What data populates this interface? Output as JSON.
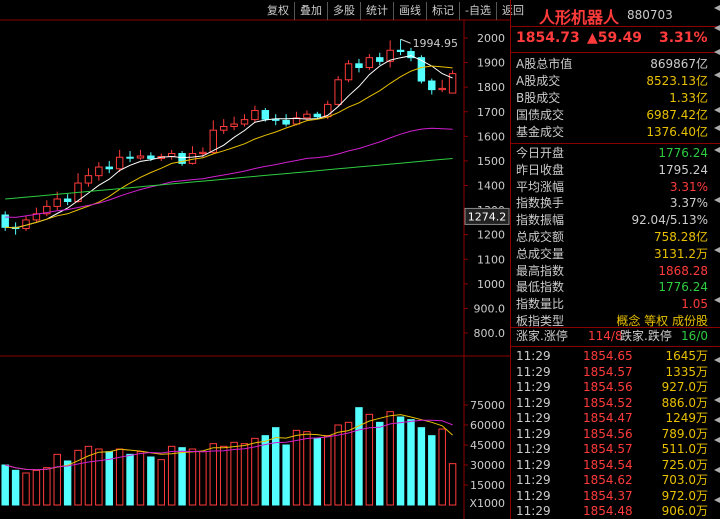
{
  "toolbar": [
    "复权",
    "叠加",
    "多股",
    "统计",
    "画线",
    "标记",
    "-自选",
    "返回"
  ],
  "stock": {
    "name": "人形机器人",
    "code": "880703",
    "price": "1854.73",
    "change": "▲59.49",
    "change_pct": "3.31%"
  },
  "summary": [
    {
      "label": "A股总市值",
      "value": "869867亿",
      "color": "#cccccc"
    },
    {
      "label": "A股成交",
      "value": "8523.13亿",
      "color": "#e8c000"
    },
    {
      "label": "B股成交",
      "value": "1.33亿",
      "color": "#e8c000"
    },
    {
      "label": "国债成交",
      "value": "6987.42亿",
      "color": "#e8c000"
    },
    {
      "label": "基金成交",
      "value": "1376.40亿",
      "color": "#e8c000"
    }
  ],
  "stats": [
    {
      "label": "今日开盘",
      "value": "1776.24",
      "color": "#2ecc40"
    },
    {
      "label": "昨日收盘",
      "value": "1795.24",
      "color": "#cccccc"
    },
    {
      "label": "平均涨幅",
      "value": "3.31%",
      "color": "#ff3b3b"
    },
    {
      "label": "指数换手",
      "value": "3.37%",
      "color": "#cccccc"
    },
    {
      "label": "指数振幅",
      "value": "92.04/5.13%",
      "color": "#cccccc"
    },
    {
      "label": "总成交额",
      "value": "758.28亿",
      "color": "#e8c000"
    },
    {
      "label": "总成交量",
      "value": "3131.2万",
      "color": "#e8c000"
    },
    {
      "label": "最高指数",
      "value": "1868.28",
      "color": "#ff3b3b"
    },
    {
      "label": "最低指数",
      "value": "1776.24",
      "color": "#2ecc40"
    },
    {
      "label": "指数量比",
      "value": "1.05",
      "color": "#ff3b3b"
    },
    {
      "label": "板指类型",
      "value": "概念 等权 成份股",
      "color": "#e8c000"
    }
  ],
  "breadth": {
    "up_label": "涨家.涨停",
    "up_value": "114/8",
    "down_label": "跌家.跌停",
    "down_value": "16/0"
  },
  "ticks": [
    {
      "time": "11:29",
      "price": "1854.65",
      "vol": "1645万"
    },
    {
      "time": "11:29",
      "price": "1854.57",
      "vol": "1335万"
    },
    {
      "time": "11:29",
      "price": "1854.56",
      "vol": "927.0万"
    },
    {
      "time": "11:29",
      "price": "1854.52",
      "vol": "886.0万"
    },
    {
      "time": "11:29",
      "price": "1854.47",
      "vol": "1249万"
    },
    {
      "time": "11:29",
      "price": "1854.56",
      "vol": "789.0万"
    },
    {
      "time": "11:29",
      "price": "1854.57",
      "vol": "511.0万"
    },
    {
      "time": "11:29",
      "price": "1854.54",
      "vol": "725.0万"
    },
    {
      "time": "11:29",
      "price": "1854.62",
      "vol": "703.0万"
    },
    {
      "time": "11:29",
      "price": "1854.37",
      "vol": "972.0万"
    },
    {
      "time": "11:29",
      "price": "1854.48",
      "vol": "906.0万"
    }
  ],
  "chart_data": {
    "type": "candlestick",
    "y_ticks": [
      "2000",
      "1900",
      "1800",
      "1700",
      "1600",
      "1500",
      "1400",
      "1300",
      "1200",
      "1100",
      "1000",
      "900.0",
      "800.0"
    ],
    "y_values": [
      2000,
      1900,
      1800,
      1700,
      1600,
      1500,
      1400,
      1300,
      1200,
      1100,
      1000,
      900,
      800
    ],
    "price_label": "1274.2",
    "high_label": "1994.95",
    "vol_ticks": [
      "75000",
      "60000",
      "45000",
      "30000",
      "15000",
      "X1000"
    ],
    "vol_values": [
      75000,
      60000,
      45000,
      30000,
      15000
    ],
    "candles": [
      {
        "o": 1280,
        "c": 1230,
        "h": 1295,
        "l": 1215,
        "v": 30000
      },
      {
        "o": 1230,
        "c": 1225,
        "h": 1250,
        "l": 1200,
        "v": 26000
      },
      {
        "o": 1225,
        "c": 1260,
        "h": 1275,
        "l": 1215,
        "v": 24000
      },
      {
        "o": 1260,
        "c": 1285,
        "h": 1310,
        "l": 1250,
        "v": 26000
      },
      {
        "o": 1285,
        "c": 1315,
        "h": 1340,
        "l": 1275,
        "v": 28000
      },
      {
        "o": 1315,
        "c": 1345,
        "h": 1375,
        "l": 1300,
        "v": 38000
      },
      {
        "o": 1345,
        "c": 1335,
        "h": 1365,
        "l": 1320,
        "v": 33000
      },
      {
        "o": 1335,
        "c": 1410,
        "h": 1450,
        "l": 1330,
        "v": 41000
      },
      {
        "o": 1410,
        "c": 1440,
        "h": 1470,
        "l": 1395,
        "v": 44000
      },
      {
        "o": 1440,
        "c": 1475,
        "h": 1495,
        "l": 1420,
        "v": 42000
      },
      {
        "o": 1475,
        "c": 1468,
        "h": 1500,
        "l": 1450,
        "v": 40000
      },
      {
        "o": 1468,
        "c": 1515,
        "h": 1545,
        "l": 1455,
        "v": 42000
      },
      {
        "o": 1515,
        "c": 1512,
        "h": 1540,
        "l": 1495,
        "v": 38000
      },
      {
        "o": 1512,
        "c": 1520,
        "h": 1545,
        "l": 1505,
        "v": 40000
      },
      {
        "o": 1520,
        "c": 1510,
        "h": 1535,
        "l": 1500,
        "v": 36000
      },
      {
        "o": 1510,
        "c": 1518,
        "h": 1530,
        "l": 1500,
        "v": 34000
      },
      {
        "o": 1518,
        "c": 1530,
        "h": 1545,
        "l": 1505,
        "v": 44000
      },
      {
        "o": 1530,
        "c": 1490,
        "h": 1540,
        "l": 1480,
        "v": 43000
      },
      {
        "o": 1490,
        "c": 1530,
        "h": 1560,
        "l": 1485,
        "v": 42000
      },
      {
        "o": 1530,
        "c": 1535,
        "h": 1555,
        "l": 1515,
        "v": 40000
      },
      {
        "o": 1535,
        "c": 1625,
        "h": 1665,
        "l": 1530,
        "v": 46000
      },
      {
        "o": 1625,
        "c": 1640,
        "h": 1670,
        "l": 1610,
        "v": 44000
      },
      {
        "o": 1640,
        "c": 1650,
        "h": 1680,
        "l": 1625,
        "v": 47000
      },
      {
        "o": 1650,
        "c": 1668,
        "h": 1690,
        "l": 1640,
        "v": 46000
      },
      {
        "o": 1668,
        "c": 1705,
        "h": 1725,
        "l": 1655,
        "v": 50000
      },
      {
        "o": 1705,
        "c": 1670,
        "h": 1715,
        "l": 1660,
        "v": 52000
      },
      {
        "o": 1670,
        "c": 1665,
        "h": 1690,
        "l": 1645,
        "v": 58000
      },
      {
        "o": 1665,
        "c": 1650,
        "h": 1690,
        "l": 1640,
        "v": 45000
      },
      {
        "o": 1650,
        "c": 1675,
        "h": 1700,
        "l": 1645,
        "v": 56000
      },
      {
        "o": 1675,
        "c": 1690,
        "h": 1705,
        "l": 1665,
        "v": 55000
      },
      {
        "o": 1690,
        "c": 1680,
        "h": 1700,
        "l": 1670,
        "v": 50000
      },
      {
        "o": 1680,
        "c": 1730,
        "h": 1745,
        "l": 1670,
        "v": 52000
      },
      {
        "o": 1730,
        "c": 1830,
        "h": 1845,
        "l": 1725,
        "v": 60000
      },
      {
        "o": 1830,
        "c": 1895,
        "h": 1910,
        "l": 1820,
        "v": 62000
      },
      {
        "o": 1895,
        "c": 1880,
        "h": 1915,
        "l": 1860,
        "v": 73000
      },
      {
        "o": 1880,
        "c": 1920,
        "h": 1935,
        "l": 1870,
        "v": 68000
      },
      {
        "o": 1920,
        "c": 1905,
        "h": 1940,
        "l": 1890,
        "v": 62000
      },
      {
        "o": 1905,
        "c": 1950,
        "h": 1990,
        "l": 1880,
        "v": 70000
      },
      {
        "o": 1950,
        "c": 1945,
        "h": 1995,
        "l": 1930,
        "v": 66000
      },
      {
        "o": 1945,
        "c": 1920,
        "h": 1960,
        "l": 1905,
        "v": 64000
      },
      {
        "o": 1920,
        "c": 1825,
        "h": 1930,
        "l": 1815,
        "v": 58000
      },
      {
        "o": 1825,
        "c": 1790,
        "h": 1835,
        "l": 1770,
        "v": 52000
      },
      {
        "o": 1790,
        "c": 1795,
        "h": 1830,
        "l": 1780,
        "v": 57000
      },
      {
        "o": 1776,
        "c": 1855,
        "h": 1868,
        "l": 1776,
        "v": 31000
      }
    ],
    "ma_colors": [
      "#ffffff",
      "#e8c000",
      "#d020d0",
      "#2ecc40"
    ],
    "vol_ma_colors": [
      "#e8c000",
      "#d020d0"
    ]
  },
  "colors": {
    "up": "#ff3b3b",
    "down": "#54ffff",
    "grid": "#8b0000",
    "axis": "#cccccc"
  }
}
